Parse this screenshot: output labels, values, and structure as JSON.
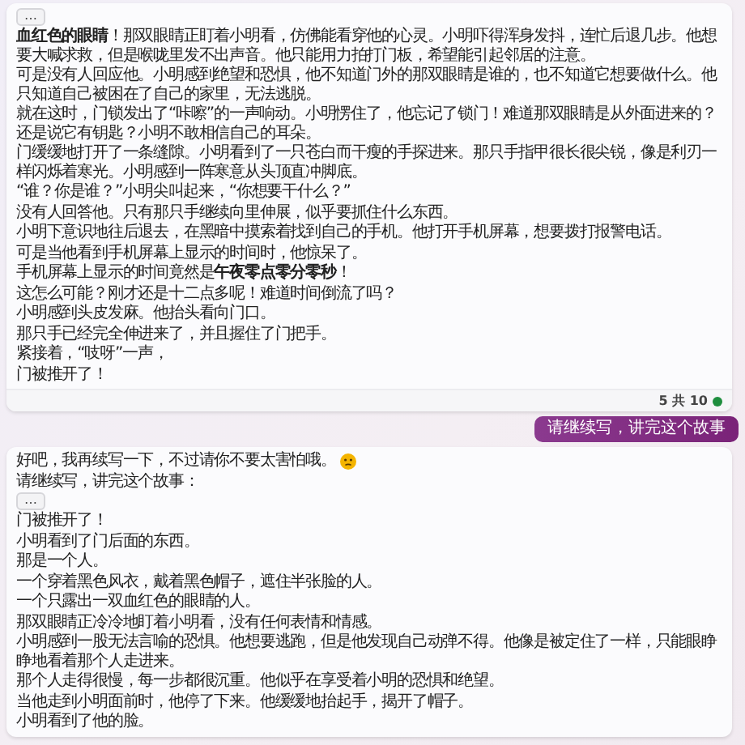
{
  "bot_reply_1": {
    "expand_label": "…",
    "paragraphs": [
      "**血红色的眼睛**！那双眼睛正盯着小明看，仿佛能看穿他的心灵。小明吓得浑身发抖，连忙后退几步。他想要大喊求救，但是喉咙里发不出声音。他只能用力拍打门板，希望能引起邻居的注意。",
      "可是没有人回应他。小明感到绝望和恐惧，他不知道门外的那双眼睛是谁的，也不知道它想要做什么。他只知道自己被困在了自己的家里，无法逃脱。",
      "就在这时，门锁发出了“咔嚓”的一声响动。小明愣住了，他忘记了锁门！难道那双眼睛是从外面进来的？还是说它有钥匙？小明不敢相信自己的耳朵。",
      "门缓缓地打开了一条缝隙。小明看到了一只苍白而干瘦的手探进来。那只手指甲很长很尖锐，像是利刃一样闪烁着寒光。小明感到一阵寒意从头顶直冲脚底。",
      "“谁？你是谁？”小明尖叫起来，“你想要干什么？”",
      "没有人回答他。只有那只手继续向里伸展，似乎要抓住什么东西。",
      "小明下意识地往后退去，在黑暗中摸索着找到自己的手机。他打开手机屏幕，想要拨打报警电话。",
      "可是当他看到手机屏幕上显示的时间时，他惊呆了。",
      "手机屏幕上显示的时间竟然是**午夜零点零分零秒**！",
      "这怎么可能？刚才还是十二点多呢！难道时间倒流了吗？",
      "小明感到头皮发麻。他抬头看向门口。",
      "那只手已经完全伸进来了，并且握住了门把手。",
      "紧接着，“吱呀”一声，",
      "门被推开了！"
    ],
    "counter": "5 共 10"
  },
  "user_message": {
    "text": "请继续写，讲完这个故事"
  },
  "bot_reply_2": {
    "intro": "好吧，我再续写一下，不过请你不要太害怕哦。",
    "prompt": "请继续写，讲完这个故事：",
    "expand_label": "…",
    "paragraphs": [
      "门被推开了！",
      "小明看到了门后面的东西。",
      "那是一个人。",
      "一个穿着黑色风衣，戴着黑色帽子，遮住半张脸的人。",
      "一个只露出一双血红色的眼睛的人。",
      "那双眼睛正冷冷地盯着小明看，没有任何表情和情感。",
      "小明感到一股无法言喻的恐惧。他想要逃跑，但是他发现自己动弹不得。他像是被定住了一样，只能眼睁睁地看着那个人走进来。",
      "那个人走得很慢，每一步都很沉重。他似乎在享受着小明的恐惧和绝望。",
      "当他走到小明面前时，他停了下来。他缓缓地抬起手，揭开了帽子。",
      "小明看到了他的脸。"
    ]
  }
}
